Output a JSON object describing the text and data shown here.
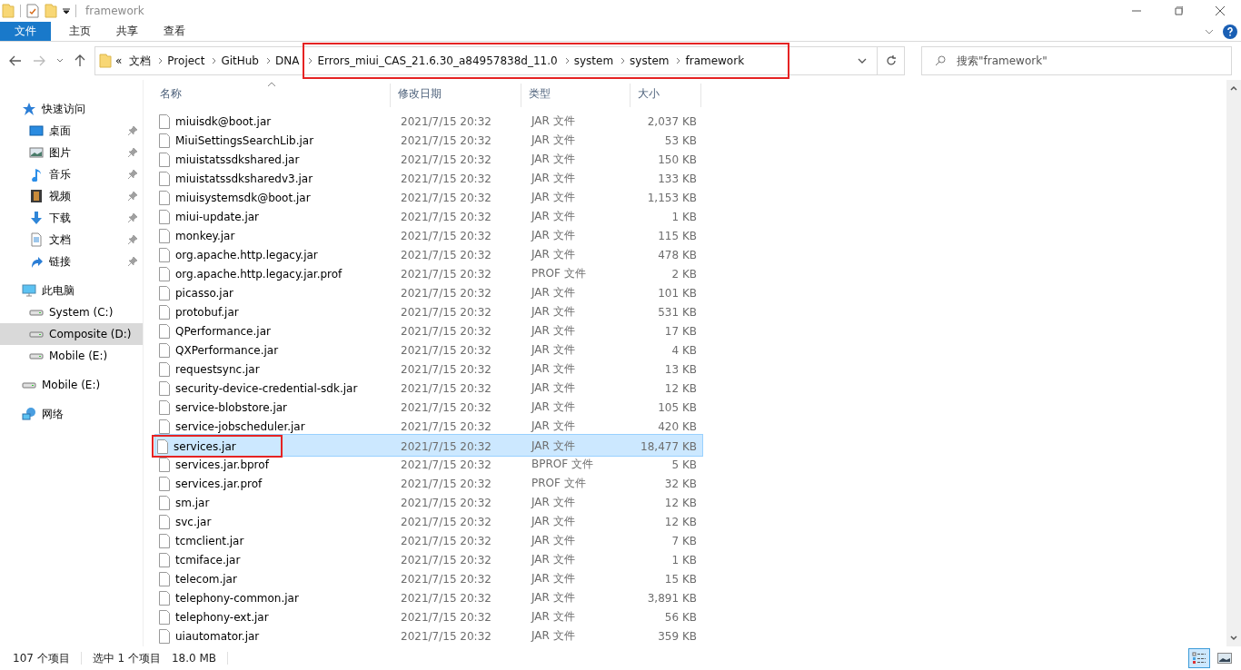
{
  "window": {
    "title": "framework"
  },
  "ribbon_tabs": [
    {
      "label": "文件",
      "selected": true
    },
    {
      "label": "主页",
      "selected": false
    },
    {
      "label": "共享",
      "selected": false
    },
    {
      "label": "查看",
      "selected": false
    }
  ],
  "address": {
    "overflow": "«",
    "breadcrumbs": [
      {
        "label": "文档",
        "annotated": false
      },
      {
        "label": "Project",
        "annotated": false
      },
      {
        "label": "GitHub",
        "annotated": false
      },
      {
        "label": "DNA",
        "annotated": false
      },
      {
        "label": "Errors_miui_CAS_21.6.30_a84957838d_11.0",
        "annotated": true
      },
      {
        "label": "system",
        "annotated": true
      },
      {
        "label": "system",
        "annotated": true
      },
      {
        "label": "framework",
        "annotated": true
      }
    ]
  },
  "search": {
    "placeholder": "搜索\"framework\""
  },
  "sidebar": {
    "items": [
      {
        "label": "快速访问",
        "kind": "quick",
        "pinned": false,
        "selected": false,
        "children": [
          {
            "label": "桌面",
            "kind": "desktop",
            "pinned": true,
            "selected": false
          },
          {
            "label": "图片",
            "kind": "pictures",
            "pinned": true,
            "selected": false
          },
          {
            "label": "音乐",
            "kind": "music",
            "pinned": true,
            "selected": false
          },
          {
            "label": "视频",
            "kind": "videos",
            "pinned": true,
            "selected": false
          },
          {
            "label": "下载",
            "kind": "downloads",
            "pinned": true,
            "selected": false
          },
          {
            "label": "文档",
            "kind": "documents",
            "pinned": true,
            "selected": false
          },
          {
            "label": "链接",
            "kind": "links",
            "pinned": true,
            "selected": false
          }
        ]
      },
      {
        "label": "此电脑",
        "kind": "pc",
        "pinned": false,
        "selected": false,
        "children": [
          {
            "label": "System (C:)",
            "kind": "drive",
            "pinned": false,
            "selected": false
          },
          {
            "label": "Composite (D:)",
            "kind": "drive",
            "pinned": false,
            "selected": true
          },
          {
            "label": "Mobile (E:)",
            "kind": "drive",
            "pinned": false,
            "selected": false
          }
        ]
      },
      {
        "label": "Mobile (E:)",
        "kind": "drive",
        "pinned": false,
        "selected": false
      },
      {
        "label": "网络",
        "kind": "network",
        "pinned": false,
        "selected": false
      }
    ]
  },
  "table": {
    "columns": [
      "名称",
      "修改日期",
      "类型",
      "大小"
    ],
    "rows": [
      {
        "name": "miuisdk@boot.jar",
        "date": "2021/7/15 20:32",
        "type": "JAR 文件",
        "size": "2,037 KB",
        "selected": false,
        "annotated": false
      },
      {
        "name": "MiuiSettingsSearchLib.jar",
        "date": "2021/7/15 20:32",
        "type": "JAR 文件",
        "size": "53 KB",
        "selected": false,
        "annotated": false
      },
      {
        "name": "miuistatssdkshared.jar",
        "date": "2021/7/15 20:32",
        "type": "JAR 文件",
        "size": "150 KB",
        "selected": false,
        "annotated": false
      },
      {
        "name": "miuistatssdksharedv3.jar",
        "date": "2021/7/15 20:32",
        "type": "JAR 文件",
        "size": "133 KB",
        "selected": false,
        "annotated": false
      },
      {
        "name": "miuisystemsdk@boot.jar",
        "date": "2021/7/15 20:32",
        "type": "JAR 文件",
        "size": "1,153 KB",
        "selected": false,
        "annotated": false
      },
      {
        "name": "miui-update.jar",
        "date": "2021/7/15 20:32",
        "type": "JAR 文件",
        "size": "1 KB",
        "selected": false,
        "annotated": false
      },
      {
        "name": "monkey.jar",
        "date": "2021/7/15 20:32",
        "type": "JAR 文件",
        "size": "115 KB",
        "selected": false,
        "annotated": false
      },
      {
        "name": "org.apache.http.legacy.jar",
        "date": "2021/7/15 20:32",
        "type": "JAR 文件",
        "size": "478 KB",
        "selected": false,
        "annotated": false
      },
      {
        "name": "org.apache.http.legacy.jar.prof",
        "date": "2021/7/15 20:32",
        "type": "PROF 文件",
        "size": "2 KB",
        "selected": false,
        "annotated": false
      },
      {
        "name": "picasso.jar",
        "date": "2021/7/15 20:32",
        "type": "JAR 文件",
        "size": "101 KB",
        "selected": false,
        "annotated": false
      },
      {
        "name": "protobuf.jar",
        "date": "2021/7/15 20:32",
        "type": "JAR 文件",
        "size": "531 KB",
        "selected": false,
        "annotated": false
      },
      {
        "name": "QPerformance.jar",
        "date": "2021/7/15 20:32",
        "type": "JAR 文件",
        "size": "17 KB",
        "selected": false,
        "annotated": false
      },
      {
        "name": "QXPerformance.jar",
        "date": "2021/7/15 20:32",
        "type": "JAR 文件",
        "size": "4 KB",
        "selected": false,
        "annotated": false
      },
      {
        "name": "requestsync.jar",
        "date": "2021/7/15 20:32",
        "type": "JAR 文件",
        "size": "13 KB",
        "selected": false,
        "annotated": false
      },
      {
        "name": "security-device-credential-sdk.jar",
        "date": "2021/7/15 20:32",
        "type": "JAR 文件",
        "size": "12 KB",
        "selected": false,
        "annotated": false
      },
      {
        "name": "service-blobstore.jar",
        "date": "2021/7/15 20:32",
        "type": "JAR 文件",
        "size": "105 KB",
        "selected": false,
        "annotated": false
      },
      {
        "name": "service-jobscheduler.jar",
        "date": "2021/7/15 20:32",
        "type": "JAR 文件",
        "size": "420 KB",
        "selected": false,
        "annotated": false
      },
      {
        "name": "services.jar",
        "date": "2021/7/15 20:32",
        "type": "JAR 文件",
        "size": "18,477 KB",
        "selected": true,
        "annotated": true
      },
      {
        "name": "services.jar.bprof",
        "date": "2021/7/15 20:32",
        "type": "BPROF 文件",
        "size": "5 KB",
        "selected": false,
        "annotated": false
      },
      {
        "name": "services.jar.prof",
        "date": "2021/7/15 20:32",
        "type": "PROF 文件",
        "size": "32 KB",
        "selected": false,
        "annotated": false
      },
      {
        "name": "sm.jar",
        "date": "2021/7/15 20:32",
        "type": "JAR 文件",
        "size": "12 KB",
        "selected": false,
        "annotated": false
      },
      {
        "name": "svc.jar",
        "date": "2021/7/15 20:32",
        "type": "JAR 文件",
        "size": "12 KB",
        "selected": false,
        "annotated": false
      },
      {
        "name": "tcmclient.jar",
        "date": "2021/7/15 20:32",
        "type": "JAR 文件",
        "size": "7 KB",
        "selected": false,
        "annotated": false
      },
      {
        "name": "tcmiface.jar",
        "date": "2021/7/15 20:32",
        "type": "JAR 文件",
        "size": "1 KB",
        "selected": false,
        "annotated": false
      },
      {
        "name": "telecom.jar",
        "date": "2021/7/15 20:32",
        "type": "JAR 文件",
        "size": "15 KB",
        "selected": false,
        "annotated": false
      },
      {
        "name": "telephony-common.jar",
        "date": "2021/7/15 20:32",
        "type": "JAR 文件",
        "size": "3,891 KB",
        "selected": false,
        "annotated": false
      },
      {
        "name": "telephony-ext.jar",
        "date": "2021/7/15 20:32",
        "type": "JAR 文件",
        "size": "56 KB",
        "selected": false,
        "annotated": false
      },
      {
        "name": "uiautomator.jar",
        "date": "2021/7/15 20:32",
        "type": "JAR 文件",
        "size": "359 KB",
        "selected": false,
        "annotated": false
      }
    ]
  },
  "status_bar": {
    "item_count": "107 个项目",
    "selection": "选中 1 个项目",
    "selection_size": "18.0 MB"
  }
}
